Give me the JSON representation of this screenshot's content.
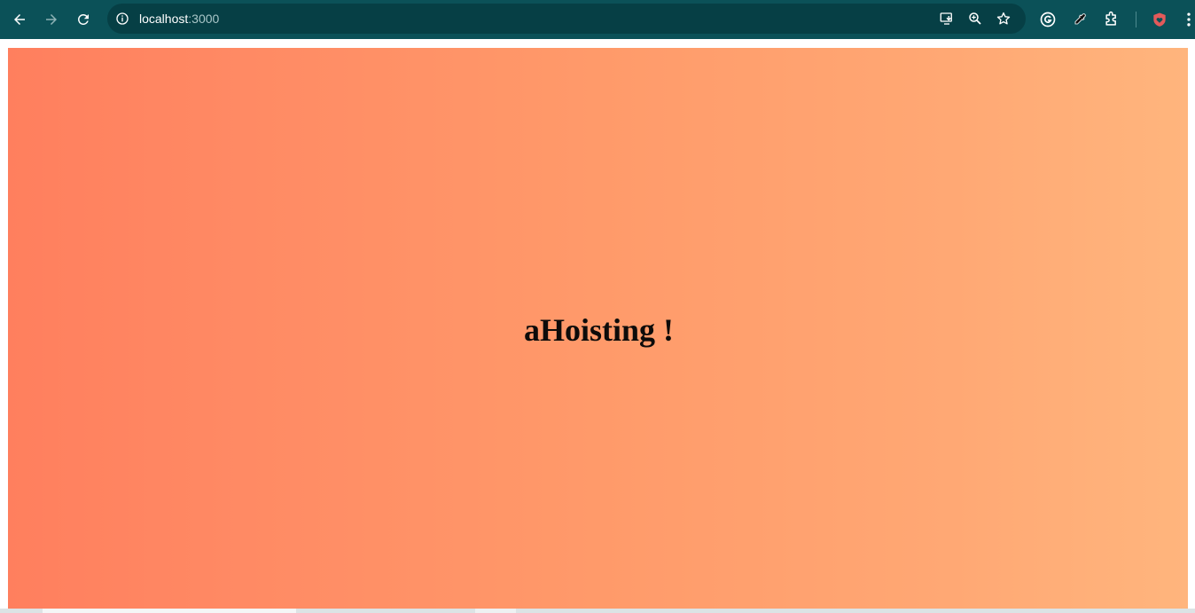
{
  "browser": {
    "url_host": "localhost",
    "url_port": ":3000"
  },
  "icons": {
    "back": "back-arrow-icon",
    "forward": "forward-arrow-icon",
    "reload": "reload-icon",
    "site_info": "info-icon",
    "install": "install-app-icon",
    "zoom": "zoom-icon",
    "bookmark": "star-icon",
    "grammarly": "grammarly-icon",
    "eyedropper": "eyedropper-icon",
    "extensions": "puzzle-icon",
    "profile_extension": "shield-heart-icon",
    "menu": "kebab-menu-icon"
  },
  "page": {
    "heading": "aHoisting !"
  },
  "colors": {
    "toolbar": "#0b5158",
    "omnibox": "#063f45",
    "gradient_start": "#ff7f5e",
    "gradient_end": "#ffb57d",
    "heading": "#0d0b0a"
  }
}
